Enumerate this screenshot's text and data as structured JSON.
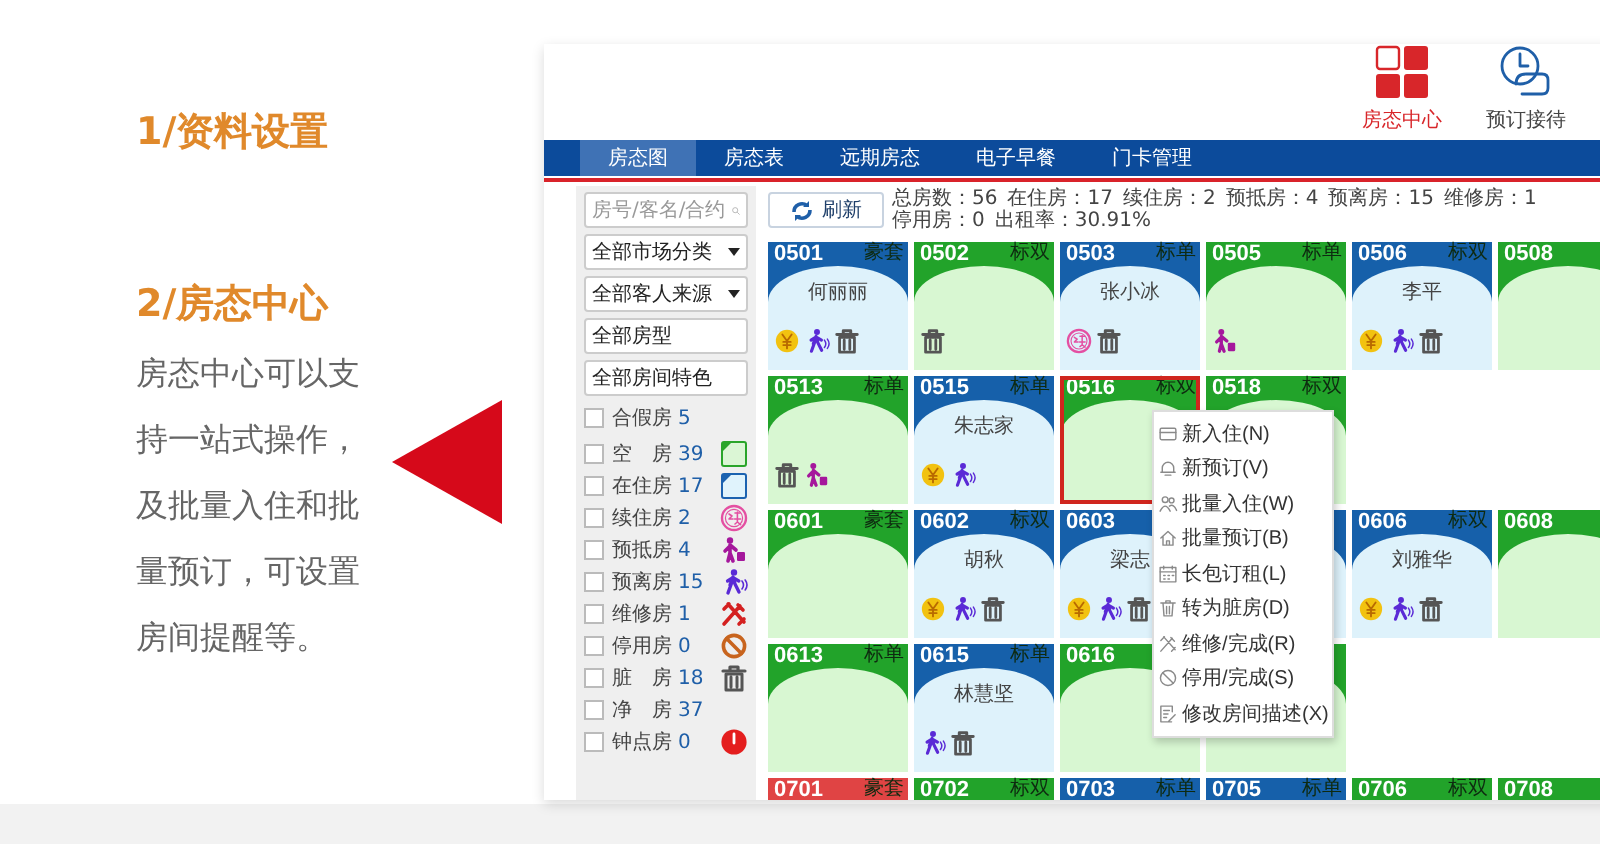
{
  "intro": {
    "heading_1": "1/资料设置",
    "heading_2": "2/房态中心",
    "text": "房态中心可以支持一站式操作，及批量入住和批量预订，可设置房间提醒等。"
  },
  "app": {
    "header_tools": [
      {
        "label": "房态中心",
        "selected": true
      },
      {
        "label": "预订接待",
        "selected": false
      }
    ],
    "tabs": [
      {
        "label": "房态图",
        "selected": true
      },
      {
        "label": "房态表",
        "selected": false
      },
      {
        "label": "远期房态",
        "selected": false
      },
      {
        "label": "电子早餐",
        "selected": false
      },
      {
        "label": "门卡管理",
        "selected": false
      }
    ],
    "search": {
      "placeholder": "房号/客名/合约"
    },
    "dropdowns": [
      "全部市场分类",
      "全部客人来源"
    ],
    "filter_fields": [
      "全部房型",
      "全部房间特色"
    ],
    "fake_room_filter": {
      "label": "合假房",
      "count": "5",
      "checked": false
    },
    "status_filters": [
      {
        "label": "空　房",
        "count": "39",
        "checked": false
      },
      {
        "label": "在住房",
        "count": "17",
        "checked": false
      },
      {
        "label": "续住房",
        "count": "2",
        "checked": false
      },
      {
        "label": "预抵房",
        "count": "4",
        "checked": false
      },
      {
        "label": "预离房",
        "count": "15",
        "checked": false
      },
      {
        "label": "维修房",
        "count": "1",
        "checked": false
      },
      {
        "label": "停用房",
        "count": "0",
        "checked": false
      },
      {
        "label": "脏　房",
        "count": "18",
        "checked": false
      },
      {
        "label": "净　房",
        "count": "37",
        "checked": false
      },
      {
        "label": "钟点房",
        "count": "0",
        "checked": false
      }
    ],
    "refresh_button": "刷新",
    "stats": [
      "总房数：56",
      "在住房：17",
      "续住房：2",
      "预抵房：4",
      "预离房：15",
      "维修房：1",
      "停用房：0",
      "出租率：30.91%"
    ],
    "room_rows": [
      {
        "rooms": [
          {
            "number": "0501",
            "type": "豪套",
            "color": "#1660aa",
            "occupied": true,
            "guest": "何丽丽",
            "icons": [
              {
                "kind": "yen"
              },
              {
                "kind": "walk"
              },
              {
                "kind": "trash"
              }
            ],
            "selected": false
          },
          {
            "number": "0502",
            "type": "标双",
            "color": "#22a32a",
            "occupied": false,
            "icons": [
              {
                "kind": "trash"
              }
            ],
            "selected": false
          },
          {
            "number": "0503",
            "type": "标单",
            "color": "#1660aa",
            "occupied": true,
            "guest": "张小冰",
            "icons": [
              {
                "kind": "renew"
              },
              {
                "kind": "trash"
              }
            ],
            "selected": false
          },
          {
            "number": "0505",
            "type": "标单",
            "color": "#22a32a",
            "occupied": false,
            "icons": [
              {
                "kind": "luggage"
              }
            ],
            "selected": false
          },
          {
            "number": "0506",
            "type": "标双",
            "color": "#1660aa",
            "occupied": true,
            "guest": "李平",
            "icons": [
              {
                "kind": "yen"
              },
              {
                "kind": "walk"
              },
              {
                "kind": "trash"
              }
            ],
            "selected": false
          },
          {
            "number": "0508",
            "color": "#22a32a",
            "occupied": false,
            "selected": false
          }
        ]
      },
      {
        "rooms": [
          {
            "number": "0513",
            "type": "标单",
            "color": "#22a32a",
            "occupied": false,
            "icons": [
              {
                "kind": "trash"
              },
              {
                "kind": "luggage"
              }
            ],
            "selected": false
          },
          {
            "number": "0515",
            "type": "标单",
            "color": "#1660aa",
            "occupied": true,
            "guest": "朱志家",
            "icons": [
              {
                "kind": "yen"
              },
              {
                "kind": "walk"
              }
            ],
            "selected": false
          },
          {
            "number": "0516",
            "type": "标双",
            "color": "#22a32a",
            "occupied": false,
            "selected": true
          },
          {
            "number": "0518",
            "type": "标双",
            "color": "#22a32a",
            "occupied": false,
            "selected": false
          }
        ]
      },
      {
        "rooms": [
          {
            "number": "0601",
            "type": "豪套",
            "color": "#22a32a",
            "occupied": false,
            "selected": false
          },
          {
            "number": "0602",
            "type": "标双",
            "color": "#1660aa",
            "occupied": true,
            "guest": "胡秋",
            "icons": [
              {
                "kind": "yen"
              },
              {
                "kind": "walk"
              },
              {
                "kind": "trash"
              }
            ],
            "selected": false
          },
          {
            "number": "0603",
            "color": "#1660aa",
            "occupied": true,
            "guest": "梁志",
            "icons": [
              {
                "kind": "yen"
              },
              {
                "kind": "walk"
              },
              {
                "kind": "trash"
              }
            ],
            "selected": false
          },
          {
            "color": "#1660aa",
            "occupied": true,
            "selected": false
          },
          {
            "number": "0606",
            "type": "标双",
            "color": "#1660aa",
            "occupied": true,
            "guest": "刘雅华",
            "icons": [
              {
                "kind": "yen"
              },
              {
                "kind": "walk"
              },
              {
                "kind": "trash"
              }
            ],
            "selected": false
          },
          {
            "number": "0608",
            "color": "#22a32a",
            "occupied": false,
            "selected": false
          }
        ]
      },
      {
        "rooms": [
          {
            "number": "0613",
            "type": "标单",
            "color": "#22a32a",
            "occupied": false,
            "selected": false
          },
          {
            "number": "0615",
            "type": "标单",
            "color": "#1660aa",
            "occupied": true,
            "guest": "林慧坚",
            "icons": [
              {
                "kind": "walk"
              },
              {
                "kind": "trash"
              }
            ],
            "selected": false
          },
          {
            "number": "0616",
            "color": "#22a32a",
            "occupied": false,
            "selected": false
          },
          {
            "color": "#22a32a",
            "occupied": false,
            "selected": false
          }
        ]
      },
      {
        "rooms": [
          {
            "number": "0701",
            "type": "豪套",
            "color": "#e04444",
            "selected": false
          },
          {
            "number": "0702",
            "type": "标双",
            "color": "#22a32a",
            "selected": false
          },
          {
            "number": "0703",
            "type": "标单",
            "color": "#1660aa",
            "selected": false
          },
          {
            "number": "0705",
            "type": "标单",
            "color": "#1660aa",
            "selected": false
          },
          {
            "number": "0706",
            "type": "标双",
            "color": "#22a32a",
            "selected": false
          },
          {
            "number": "0708",
            "color": "#22a32a",
            "selected": false
          }
        ]
      }
    ],
    "context_menu": [
      "新入住(N)",
      "新预订(V)",
      "批量入住(W)",
      "批量预订(B)",
      "长包订租(L)",
      "转为脏房(D)",
      "维修/完成(R)",
      "停用/完成(S)",
      "修改房间描述(X)"
    ]
  }
}
